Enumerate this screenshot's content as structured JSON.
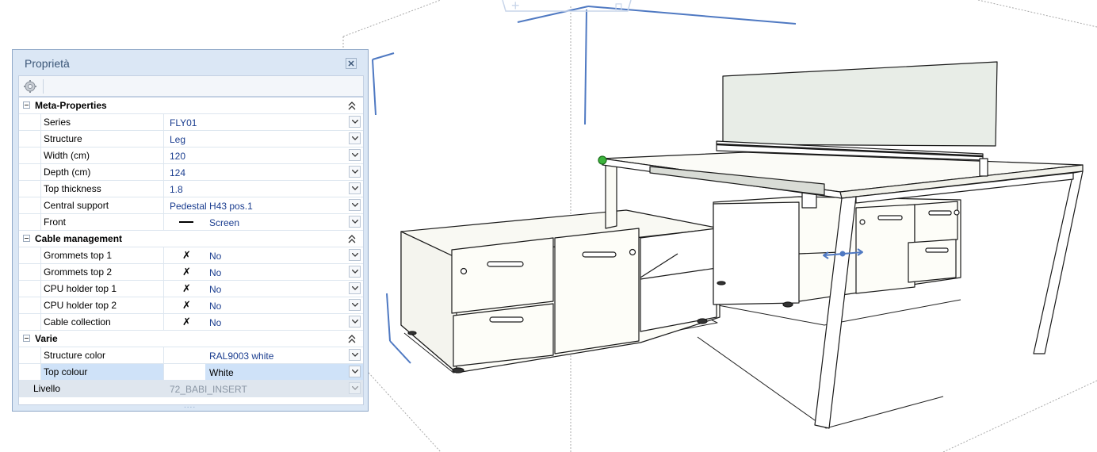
{
  "panel": {
    "title": "Proprietà",
    "categories": [
      {
        "label": "Meta-Properties",
        "rows": [
          {
            "name": "Series",
            "value": "FLY01"
          },
          {
            "name": "Structure",
            "value": "Leg"
          },
          {
            "name": "Width (cm)",
            "value": "120"
          },
          {
            "name": "Depth (cm)",
            "value": "124"
          },
          {
            "name": "Top thickness",
            "value": "1.8"
          },
          {
            "name": "Central support",
            "value": "Pedestal H43 pos.1"
          },
          {
            "name": "Front",
            "value": "Screen"
          }
        ]
      },
      {
        "label": "Cable management",
        "rows": [
          {
            "name": "Grommets top 1",
            "symbol": "✗",
            "value": "No"
          },
          {
            "name": "Grommets top 2",
            "symbol": "✗",
            "value": "No"
          },
          {
            "name": "CPU holder top 1",
            "symbol": "✗",
            "value": "No"
          },
          {
            "name": "CPU holder top 2",
            "symbol": "✗",
            "value": "No"
          },
          {
            "name": "Cable collection",
            "symbol": "✗",
            "value": "No"
          }
        ]
      },
      {
        "label": "Varie",
        "rows": [
          {
            "name": "Structure color",
            "value": "RAL9003 white"
          },
          {
            "name": "Top colour",
            "value": "White"
          }
        ]
      }
    ],
    "livello": {
      "name": "Livello",
      "value": "72_BABI_INSERT"
    },
    "resize_grip": "....",
    "icons": [
      "gear-icon",
      "close-icon",
      "chevron-down-icon",
      "collapse-up-icon",
      "minus-icon"
    ]
  },
  "colors": {
    "panel_bg": "#dbe7f5",
    "title_text": "#3b5677",
    "value_text": "#1a3d8f",
    "selected_row": "#cfe2f8",
    "gizmo_blue": "#4f79c2",
    "panel_fill": "#e8ede7",
    "handle_green": "#3cb43c"
  }
}
